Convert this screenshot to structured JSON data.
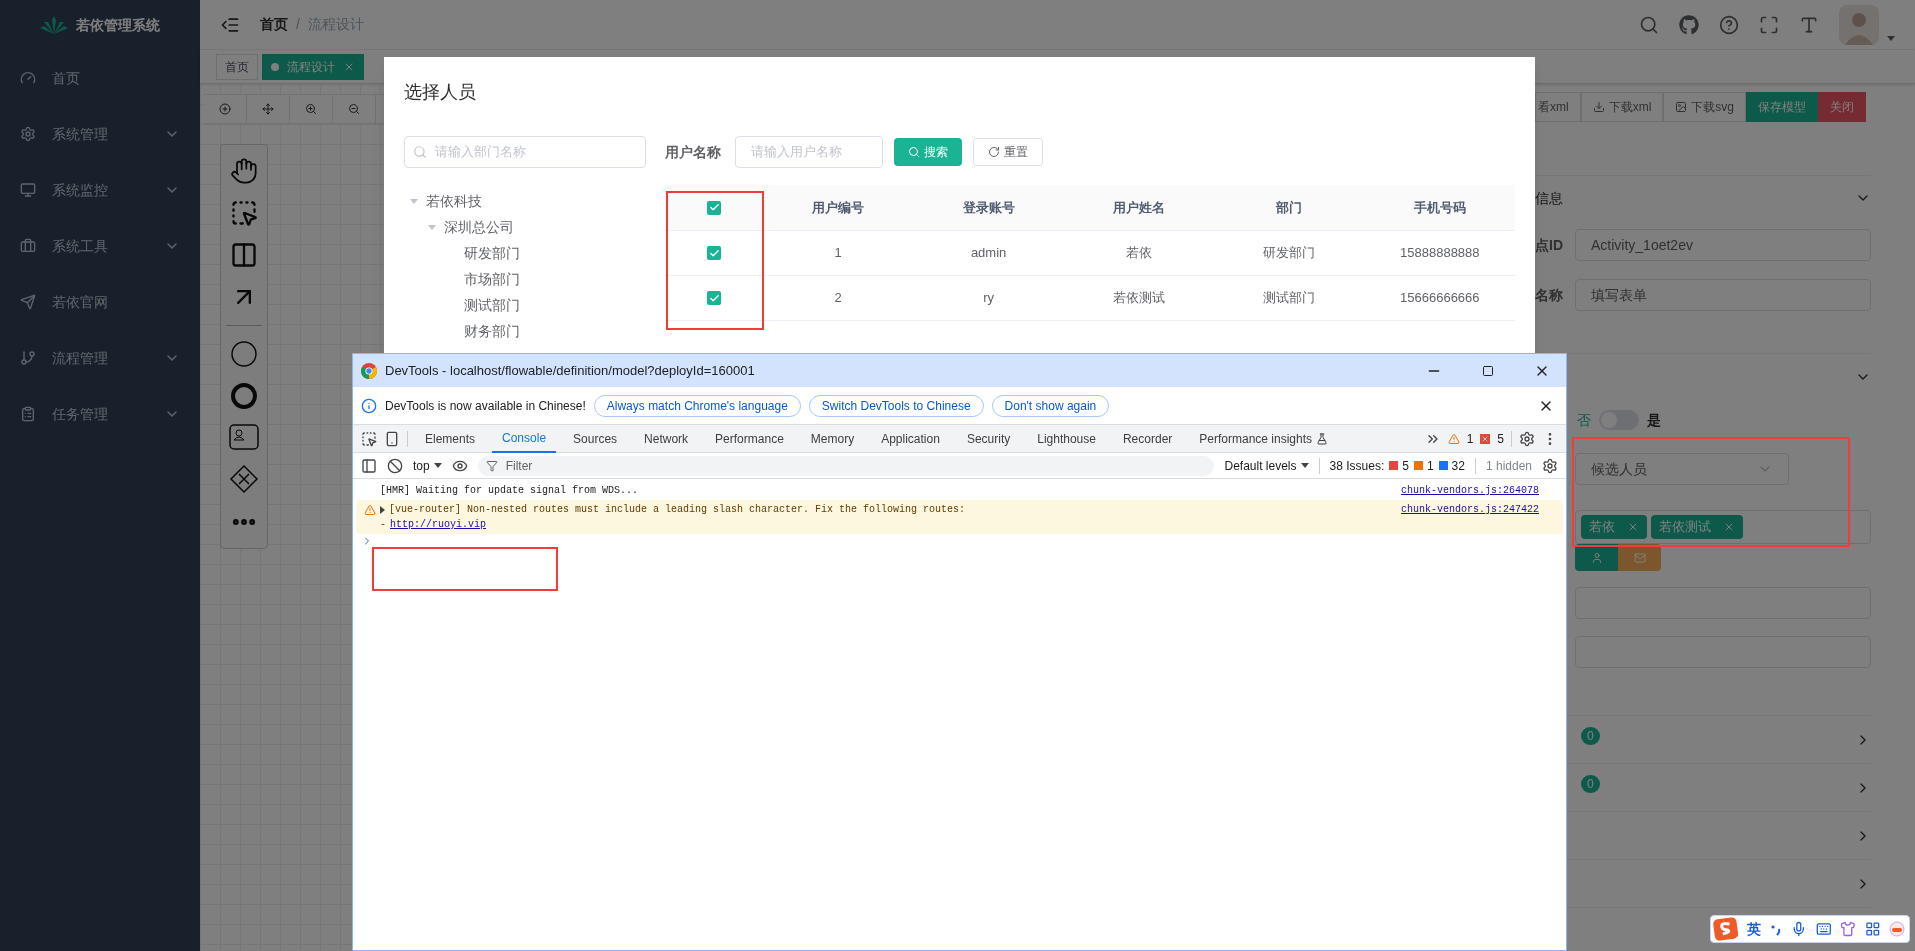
{
  "sidebar": {
    "title": "若依管理系统",
    "items": [
      {
        "label": "首页",
        "has_children": false
      },
      {
        "label": "系统管理",
        "has_children": true
      },
      {
        "label": "系统监控",
        "has_children": true
      },
      {
        "label": "系统工具",
        "has_children": true
      },
      {
        "label": "若依官网",
        "has_children": false
      },
      {
        "label": "流程管理",
        "has_children": true
      },
      {
        "label": "任务管理",
        "has_children": true
      }
    ]
  },
  "header": {
    "breadcrumb": [
      "首页",
      "流程设计"
    ],
    "separator": "/"
  },
  "tags": [
    {
      "label": "首页",
      "selected": false
    },
    {
      "label": "流程设计",
      "selected": true
    }
  ],
  "designer": {
    "toolbar": [
      {
        "label": "看xml"
      },
      {
        "label": "下载xml"
      },
      {
        "label": "下载svg"
      },
      {
        "label": "保存模型"
      },
      {
        "label": "关闭"
      }
    ]
  },
  "properties_panel": {
    "section_title": "信息",
    "fields": [
      {
        "label": "点ID",
        "value": "Activity_1oet2ev"
      },
      {
        "label": "名称",
        "value": "填写表单"
      }
    ],
    "switch": {
      "off_label": "否",
      "on_label": "是",
      "on": false
    },
    "assignee_type": "候选人员",
    "assignees": [
      "若依",
      "若依测试"
    ],
    "badges": [
      "0",
      "0"
    ]
  },
  "dialog": {
    "title": "选择人员",
    "dept_search_placeholder": "请输入部门名称",
    "dept_tree": [
      {
        "label": "若依科技",
        "expanded": true,
        "children": [
          {
            "label": "深圳总公司",
            "expanded": true,
            "children": [
              {
                "label": "研发部门"
              },
              {
                "label": "市场部门"
              },
              {
                "label": "测试部门"
              },
              {
                "label": "财务部门"
              }
            ]
          }
        ]
      }
    ],
    "filter_label": "用户名称",
    "filter_placeholder": "请输入用户名称",
    "search_button": "搜索",
    "reset_button": "重置",
    "table": {
      "all_selected": true,
      "columns": [
        "用户编号",
        "登录账号",
        "用户姓名",
        "部门",
        "手机号码"
      ],
      "rows": [
        {
          "selected": true,
          "cells": [
            "1",
            "admin",
            "若依",
            "研发部门",
            "15888888888"
          ]
        },
        {
          "selected": true,
          "cells": [
            "2",
            "ry",
            "若依测试",
            "测试部门",
            "15666666666"
          ]
        }
      ]
    }
  },
  "devtools": {
    "title": "DevTools - localhost/flowable/definition/model?deployId=160001",
    "infobar": {
      "text": "DevTools is now available in Chinese!",
      "buttons": [
        "Always match Chrome's language",
        "Switch DevTools to Chinese",
        "Don't show again"
      ]
    },
    "tabs": [
      {
        "label": "Elements",
        "selected": false
      },
      {
        "label": "Console",
        "selected": true
      },
      {
        "label": "Sources",
        "selected": false
      },
      {
        "label": "Network",
        "selected": false
      },
      {
        "label": "Performance",
        "selected": false
      },
      {
        "label": "Memory",
        "selected": false
      },
      {
        "label": "Application",
        "selected": false
      },
      {
        "label": "Security",
        "selected": false
      },
      {
        "label": "Lighthouse",
        "selected": false
      },
      {
        "label": "Recorder",
        "selected": false
      },
      {
        "label": "Performance insights",
        "selected": false
      }
    ],
    "warning_count": "1",
    "error_count": "5",
    "context": "top",
    "filter_placeholder": "Filter",
    "levels": "Default levels",
    "issues_label": "38 Issues:",
    "issue_counts": [
      {
        "kind": "error",
        "count": "5"
      },
      {
        "kind": "warning",
        "count": "1"
      },
      {
        "kind": "info",
        "count": "32"
      }
    ],
    "hidden": "1 hidden",
    "messages": [
      {
        "kind": "log",
        "text": "[HMR] Waiting for update signal from WDS...",
        "source": "chunk-vendors.js:264078"
      },
      {
        "kind": "warning",
        "text": "[vue-router] Non-nested routes must include a leading slash character. Fix the following routes:",
        "detail_prefix": "-",
        "link": "http://ruoyi.vip",
        "source": "chunk-vendors.js:247422"
      }
    ]
  },
  "ime": {
    "mode": "英"
  }
}
